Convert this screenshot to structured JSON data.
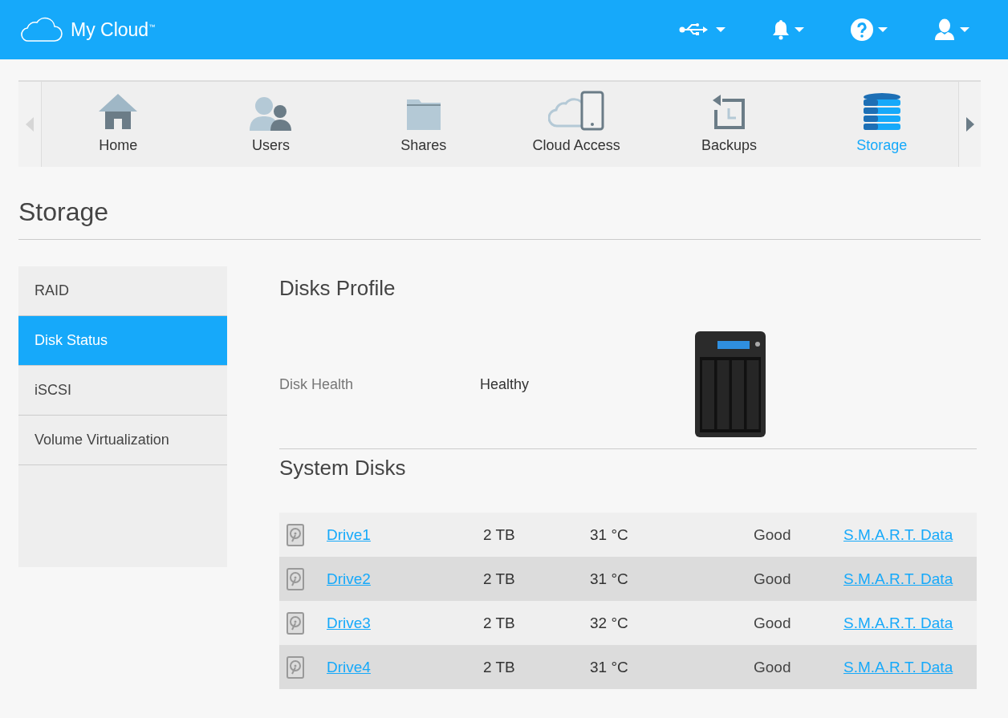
{
  "header": {
    "logo_text": "My Cloud$^{™}$"
  },
  "nav": {
    "items": [
      {
        "label": "Home",
        "kind": "home",
        "selected": false
      },
      {
        "label": "Users",
        "kind": "users",
        "selected": false
      },
      {
        "label": "Shares",
        "kind": "shares",
        "selected": false
      },
      {
        "label": "Cloud Access",
        "kind": "cloud",
        "selected": false
      },
      {
        "label": "Backups",
        "kind": "backups",
        "selected": false
      },
      {
        "label": "Storage",
        "kind": "storage",
        "selected": true
      }
    ]
  },
  "page_title": "Storage",
  "sidebar": {
    "items": [
      {
        "label": "RAID",
        "selected": false
      },
      {
        "label": "Disk Status",
        "selected": true
      },
      {
        "label": "iSCSI",
        "selected": false
      },
      {
        "label": "Volume Virtualization",
        "selected": false
      }
    ]
  },
  "disks_profile": {
    "title": "Disks Profile",
    "health_label": "Disk Health",
    "health_value": "Healthy"
  },
  "system_disks": {
    "title": "System Disks",
    "rows": [
      {
        "name": "Drive1",
        "size": "2 TB",
        "temp": "31 °C",
        "status": "Good",
        "link": "S.M.A.R.T. Data"
      },
      {
        "name": "Drive2",
        "size": "2 TB",
        "temp": "31 °C",
        "status": "Good",
        "link": "S.M.A.R.T. Data"
      },
      {
        "name": "Drive3",
        "size": "2 TB",
        "temp": "32 °C",
        "status": "Good",
        "link": "S.M.A.R.T. Data"
      },
      {
        "name": "Drive4",
        "size": "2 TB",
        "temp": "31 °C",
        "status": "Good",
        "link": "S.M.A.R.T. Data"
      }
    ]
  }
}
